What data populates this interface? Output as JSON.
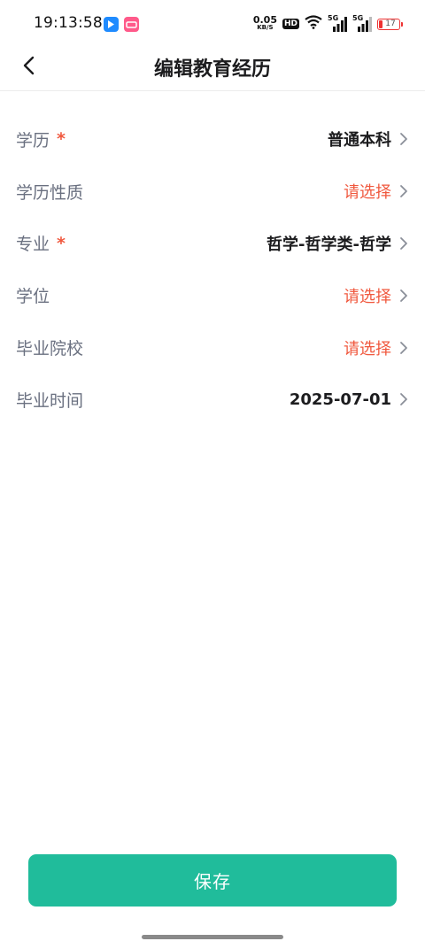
{
  "status_bar": {
    "time": "19:13:58",
    "net_speed_value": "0.05",
    "net_speed_unit": "KB/S",
    "hd_label": "HD",
    "sim1_label": "5G",
    "sim2_label": "5G",
    "battery_level": "17"
  },
  "header": {
    "title": "编辑教育经历"
  },
  "form": {
    "rows": [
      {
        "label": "学历",
        "required": "*",
        "value": "普通本科"
      },
      {
        "label": "学历性质",
        "value": "请选择"
      },
      {
        "label": "专业",
        "required": "*",
        "value": "哲学-哲学类-哲学"
      },
      {
        "label": "学位",
        "value": "请选择"
      },
      {
        "label": "毕业院校",
        "value": "请选择"
      },
      {
        "label": "毕业时间",
        "value": "2025-07-01"
      }
    ]
  },
  "footer": {
    "save_label": "保存"
  },
  "colors": {
    "accent": "#20bc9b",
    "placeholder": "#f0583e",
    "required": "#f0583e",
    "label": "#6a7080"
  }
}
